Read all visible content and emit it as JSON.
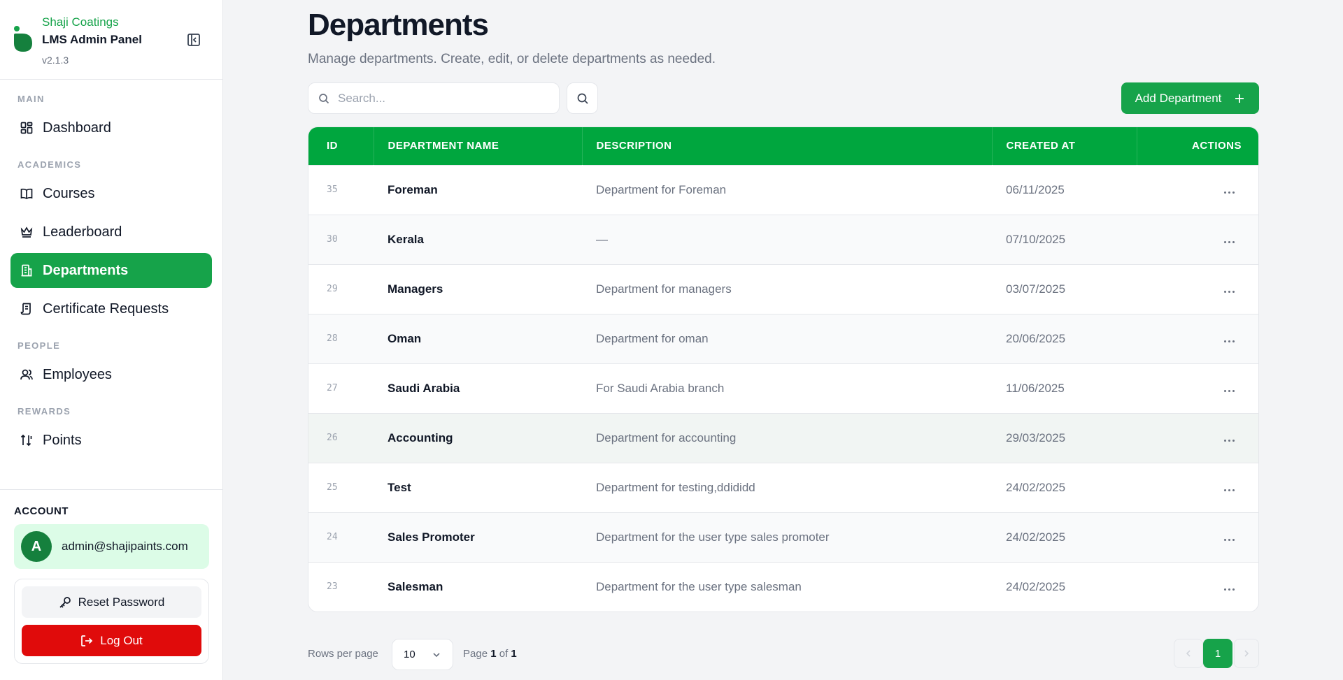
{
  "brand": {
    "company": "Shaji Coatings",
    "title": "LMS Admin Panel",
    "version": "v2.1.3"
  },
  "nav": {
    "sections": {
      "main": "MAIN",
      "academics": "ACADEMICS",
      "people": "PEOPLE",
      "rewards": "REWARDS"
    },
    "items": [
      {
        "label": "Dashboard",
        "icon": "dashboard-grid-icon"
      },
      {
        "label": "Courses",
        "icon": "book-icon"
      },
      {
        "label": "Leaderboard",
        "icon": "crown-icon"
      },
      {
        "label": "Departments",
        "icon": "building-icon",
        "active": true
      },
      {
        "label": "Certificate Requests",
        "icon": "scroll-icon"
      },
      {
        "label": "Employees",
        "icon": "users-icon"
      },
      {
        "label": "Points",
        "icon": "sort-arrows-icon"
      }
    ]
  },
  "account": {
    "heading": "ACCOUNT",
    "avatar_letter": "A",
    "email": "admin@shajipaints.com",
    "reset_label": "Reset Password",
    "logout_label": "Log Out"
  },
  "page": {
    "title": "Departments",
    "subtitle": "Manage departments. Create, edit, or delete departments as needed."
  },
  "toolbar": {
    "search_placeholder": "Search...",
    "add_label": "Add Department"
  },
  "table": {
    "columns": [
      "ID",
      "DEPARTMENT NAME",
      "DESCRIPTION",
      "CREATED AT",
      "ACTIONS"
    ],
    "rows": [
      {
        "id": "35",
        "name": "Foreman",
        "description": "Department for Foreman",
        "created": "06/11/2025"
      },
      {
        "id": "30",
        "name": "Kerala",
        "description": "—",
        "created": "07/10/2025"
      },
      {
        "id": "29",
        "name": "Managers",
        "description": "Department for managers",
        "created": "03/07/2025"
      },
      {
        "id": "28",
        "name": "Oman",
        "description": "Department for oman",
        "created": "20/06/2025"
      },
      {
        "id": "27",
        "name": "Saudi Arabia",
        "description": "For Saudi Arabia branch",
        "created": "11/06/2025"
      },
      {
        "id": "26",
        "name": "Accounting",
        "description": "Department for accounting",
        "created": "29/03/2025"
      },
      {
        "id": "25",
        "name": "Test",
        "description": "Department for testing,ddididd",
        "created": "24/02/2025"
      },
      {
        "id": "24",
        "name": "Sales Promoter",
        "description": "Department for the user type sales promoter",
        "created": "24/02/2025"
      },
      {
        "id": "23",
        "name": "Salesman",
        "description": "Department for the user type salesman",
        "created": "24/02/2025"
      }
    ]
  },
  "pagination": {
    "rows_label": "Rows per page",
    "rows_value": "10",
    "page_word": "Page",
    "current": "1",
    "of_word": "of",
    "total": "1"
  },
  "colors": {
    "accent": "#16a34a",
    "header": "#00a63e",
    "danger": "#e00b0b"
  }
}
